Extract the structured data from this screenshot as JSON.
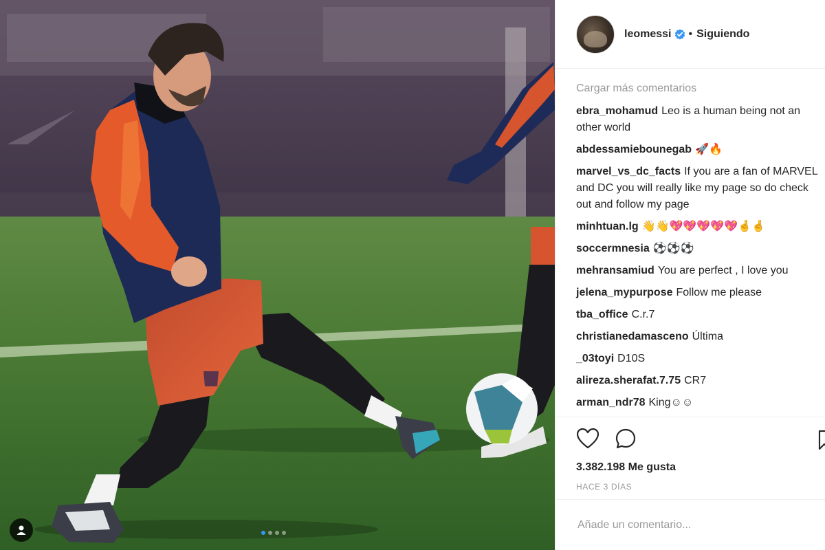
{
  "header": {
    "username": "leomessi",
    "separator": "•",
    "follow_status": "Siguiendo",
    "verified_icon": "verified-badge-icon"
  },
  "comments": {
    "load_more": "Cargar más comentarios",
    "items": [
      {
        "author": "ebra_mohamud",
        "text": "Leo is a human being not an other world"
      },
      {
        "author": "abdessamiebounegab",
        "text": "🚀🔥"
      },
      {
        "author": "marvel_vs_dc_facts",
        "text": "If you are a fan of MARVEL and DC you will really like my page so do check out and follow my page"
      },
      {
        "author": "minhtuan.lg",
        "text": "👋👋💖💖💖💖💖🤞🤞"
      },
      {
        "author": "soccermnesia",
        "text": "⚽⚽⚽"
      },
      {
        "author": "mehransamiud",
        "text": "You are perfect , I love you"
      },
      {
        "author": "jelena_mypurpose",
        "text": "Follow me please"
      },
      {
        "author": "tba_office",
        "text": "C.r.7"
      },
      {
        "author": "christianedamasceno",
        "text": "Última"
      },
      {
        "author": "_03toyi",
        "text": "D10S"
      },
      {
        "author": "alireza.sherafat.7.75",
        "text": "CR7"
      },
      {
        "author": "arman_ndr78",
        "text": "King☺☺"
      }
    ]
  },
  "actions": {
    "likes": "3.382.198 Me gusta",
    "timestamp": "HACE 3 DÍAS"
  },
  "add_comment": {
    "placeholder": "Añade un comentario..."
  },
  "colors": {
    "accent": "#3897f0",
    "text": "#262626",
    "muted": "#999999"
  }
}
